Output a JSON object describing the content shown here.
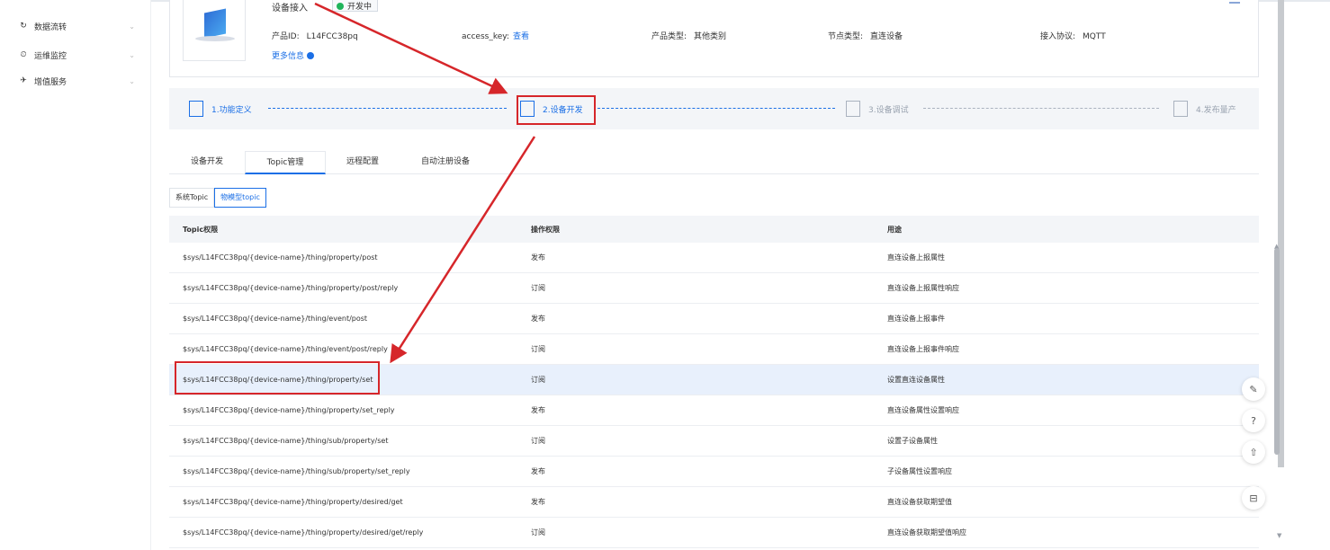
{
  "sidebar": {
    "items": [
      {
        "icon": "flow-icon",
        "glyph": "↻",
        "label": "数据流转"
      },
      {
        "icon": "monitor-icon",
        "glyph": "⏲",
        "label": "运维监控"
      },
      {
        "icon": "service-icon",
        "glyph": "✈",
        "label": "增值服务"
      }
    ]
  },
  "product": {
    "device_title": "设备接入",
    "status": "开发中",
    "product_id_label": "产品ID:",
    "product_id": "L14FCC38pq",
    "access_key_label": "access_key:",
    "access_key_link": "查看",
    "product_type_label": "产品类型:",
    "product_type": "其他类别",
    "node_type_label": "节点类型:",
    "node_type": "直连设备",
    "protocol_label": "接入协议:",
    "protocol": "MQTT",
    "more_info": "更多信息"
  },
  "steps": [
    {
      "label": "1.功能定义",
      "state": "done"
    },
    {
      "label": "2.设备开发",
      "state": "active"
    },
    {
      "label": "3.设备调试",
      "state": "inactive"
    },
    {
      "label": "4.发布量产",
      "state": "inactive"
    }
  ],
  "tabs": [
    "设备开发",
    "Topic管理",
    "远程配置",
    "自动注册设备"
  ],
  "active_tab": "Topic管理",
  "subtabs": [
    "系统Topic",
    "物模型topic"
  ],
  "active_subtab": "物模型topic",
  "table": {
    "headers": [
      "Topic权限",
      "操作权限",
      "用途"
    ],
    "rows": [
      [
        "$sys/L14FCC38pq/{device-name}/thing/property/post",
        "发布",
        "直连设备上报属性"
      ],
      [
        "$sys/L14FCC38pq/{device-name}/thing/property/post/reply",
        "订阅",
        "直连设备上报属性响应"
      ],
      [
        "$sys/L14FCC38pq/{device-name}/thing/event/post",
        "发布",
        "直连设备上报事件"
      ],
      [
        "$sys/L14FCC38pq/{device-name}/thing/event/post/reply",
        "订阅",
        "直连设备上报事件响应"
      ],
      [
        "$sys/L14FCC38pq/{device-name}/thing/property/set",
        "订阅",
        "设置直连设备属性"
      ],
      [
        "$sys/L14FCC38pq/{device-name}/thing/property/set_reply",
        "发布",
        "直连设备属性设置响应"
      ],
      [
        "$sys/L14FCC38pq/{device-name}/thing/sub/property/set",
        "订阅",
        "设置子设备属性"
      ],
      [
        "$sys/L14FCC38pq/{device-name}/thing/sub/property/set_reply",
        "发布",
        "子设备属性设置响应"
      ],
      [
        "$sys/L14FCC38pq/{device-name}/thing/property/desired/get",
        "发布",
        "直连设备获取期望值"
      ],
      [
        "$sys/L14FCC38pq/{device-name}/thing/property/desired/get/reply",
        "订阅",
        "直连设备获取期望值响应"
      ]
    ],
    "highlighted_row": 4
  },
  "float_buttons": [
    {
      "icon": "edit-icon",
      "glyph": "✎"
    },
    {
      "icon": "help-icon",
      "glyph": "?"
    },
    {
      "icon": "top-icon",
      "glyph": "⇧"
    },
    {
      "icon": "collapse-icon",
      "glyph": "⊟"
    }
  ],
  "colors": {
    "accent": "#1b6fe6",
    "annotation": "#d6262a",
    "status": "#1fb45a"
  }
}
